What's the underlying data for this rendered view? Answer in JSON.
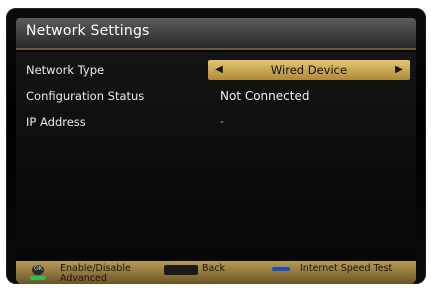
{
  "window": {
    "title": "Network Settings"
  },
  "rows": [
    {
      "label": "Network Type",
      "type": "selector",
      "value": "Wired Device"
    },
    {
      "label": "Configuration Status",
      "type": "text",
      "value": "Not Connected"
    },
    {
      "label": "IP Address",
      "type": "text",
      "value": "-"
    }
  ],
  "footer": {
    "enable_disable": "Enable/Disable",
    "advanced": "Advanced",
    "back": "Back",
    "internet_speed_test": "Internet Speed Test"
  },
  "icons": {
    "selector_left": "left-arrow-icon",
    "selector_right": "right-arrow-icon",
    "ok": "ok-button-icon",
    "green": "green-key-icon",
    "return": "return-key-icon",
    "blue": "blue-key-icon"
  },
  "colors": {
    "accent_gold": "#e2c86f",
    "footer_gold": "#b79b55",
    "background": "#000000",
    "green_key": "#2fbf4a",
    "blue_key": "#1a4fc4"
  }
}
